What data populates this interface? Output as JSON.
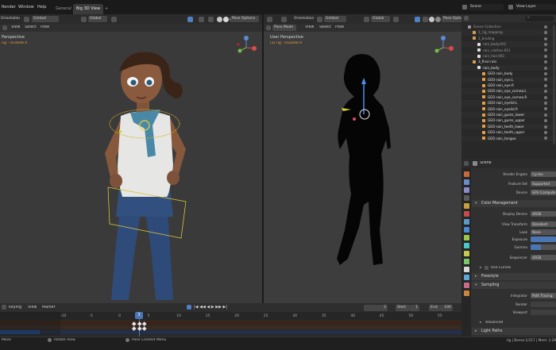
{
  "menu": {
    "items": [
      "Render",
      "Window",
      "Help"
    ],
    "workspaces": [
      {
        "label": "General",
        "active": false
      },
      {
        "label": "Big 3D View",
        "active": true
      }
    ],
    "add_tab": "+"
  },
  "top_right": {
    "scene_label": "Scene",
    "view_layer_label": "View Layer"
  },
  "left_viewport": {
    "orientation_label": "Orientation",
    "transform_value": "Gimbal",
    "pivot_value": "Global",
    "pose_options_label": "Pose Options",
    "menu": [
      "View",
      "Select",
      "Pose"
    ],
    "title": "Perspective",
    "subtitle": "rig : invalide.R"
  },
  "right_viewport": {
    "mode_value": "Pose Mode",
    "orientation_label": "Orientation",
    "transform_value": "Gimbal",
    "pivot_value": "Global",
    "pose_options_label": "Pose Options",
    "menu": [
      "View",
      "Select",
      "Pose"
    ],
    "title": "User Perspective",
    "subtitle": "(3) rig : invalide.R"
  },
  "outliner": {
    "search_placeholder": "",
    "rows": [
      {
        "label": "Scene Collection",
        "indent": 0,
        "color": "#9a9a9a"
      },
      {
        "label": "1_rig_mapping",
        "indent": 1,
        "color": "#9a9a9a"
      },
      {
        "label": "2_binding",
        "indent": 1,
        "color": "#9a9a9a"
      },
      {
        "label": "rain_body.001",
        "indent": 2,
        "color": "#9a9a9a"
      },
      {
        "label": "rain_clothes.001",
        "indent": 2,
        "color": "#9a9a9a"
      },
      {
        "label": "rain_hair.001",
        "indent": 2,
        "color": "#9a9a9a"
      },
      {
        "label": "3_final rain",
        "indent": 1,
        "color": "#e0e0e0"
      },
      {
        "label": "rain_body",
        "indent": 2,
        "color": "#e0e0e0"
      },
      {
        "label": "GEO-rain_body",
        "indent": 3,
        "color": "#e0e0e0"
      },
      {
        "label": "GEO-rain_eye.L",
        "indent": 3,
        "color": "#e0e0e0"
      },
      {
        "label": "GEO-rain_eye.R",
        "indent": 3,
        "color": "#e0e0e0"
      },
      {
        "label": "GEO-rain_eye_cornea.L",
        "indent": 3,
        "color": "#e0e0e0"
      },
      {
        "label": "GEO-rain_eye_cornea.R",
        "indent": 3,
        "color": "#e0e0e0"
      },
      {
        "label": "GEO-rain_eyelid.L",
        "indent": 3,
        "color": "#e0e0e0"
      },
      {
        "label": "GEO-rain_eyelid.R",
        "indent": 3,
        "color": "#e0e0e0"
      },
      {
        "label": "GEO-rain_gums_lower",
        "indent": 3,
        "color": "#e0e0e0"
      },
      {
        "label": "GEO-rain_gums_upper",
        "indent": 3,
        "color": "#e0e0e0"
      },
      {
        "label": "GEO-rain_teeth_lower",
        "indent": 3,
        "color": "#e0e0e0"
      },
      {
        "label": "GEO-rain_teeth_upper",
        "indent": 3,
        "color": "#e0e0e0"
      },
      {
        "label": "GEO-rain_tongue",
        "indent": 3,
        "color": "#e0e0e0"
      }
    ]
  },
  "properties": {
    "breadcrumb": "Scene",
    "render_engine_label": "Render Engine",
    "render_engine_value": "Cycles",
    "feature_set_label": "Feature Set",
    "feature_set_value": "Supported",
    "device_label": "Device",
    "device_value": "GPU Compute",
    "color_management_header": "Color Management",
    "display_device_label": "Display Device",
    "display_device_value": "sRGB",
    "view_transform_label": "View Transform",
    "view_transform_value": "Standard",
    "look_label": "Look",
    "look_value": "None",
    "exposure_label": "Exposure",
    "gamma_label": "Gamma",
    "sequencer_label": "Sequencer",
    "sequencer_value": "sRGB",
    "use_curves_label": "Use Curves",
    "freestyle_header": "Freestyle",
    "sampling_header": "Sampling",
    "integrator_label": "Integrator",
    "integrator_value": "Path Tracing",
    "render_label": "Render",
    "viewport_label": "Viewport",
    "advanced_header": "Advanced",
    "light_paths_header": "Light Paths"
  },
  "timeline": {
    "menu": [
      "Keying",
      "View",
      "Marker"
    ],
    "current_frame": "3",
    "start_label": "Start",
    "start_value": "1",
    "end_label": "End",
    "end_value": "100",
    "ticks": [
      "-10",
      "-5",
      "0",
      "5",
      "10",
      "15",
      "20",
      "25",
      "30",
      "35",
      "40",
      "45",
      "50",
      "55"
    ],
    "tick_values": [
      -10,
      -5,
      0,
      5,
      10,
      15,
      20,
      25,
      30,
      35,
      40,
      45,
      50,
      55
    ],
    "playhead": "3"
  },
  "statusbar": {
    "left": "Move",
    "rotate": "Rotate View",
    "context": "Pose Context Menu",
    "right": "rig | Bones:1/217 | Mem: 3.28"
  },
  "colors": {
    "accent": "#4a77b4",
    "selection_orange": "#e8a33b",
    "bone_yellow": "#d8c23a",
    "shirt": "#e8e8e6",
    "jeans": "#2e4a78",
    "skin": "#8a5a3e",
    "scarf": "#4a8aa8"
  }
}
